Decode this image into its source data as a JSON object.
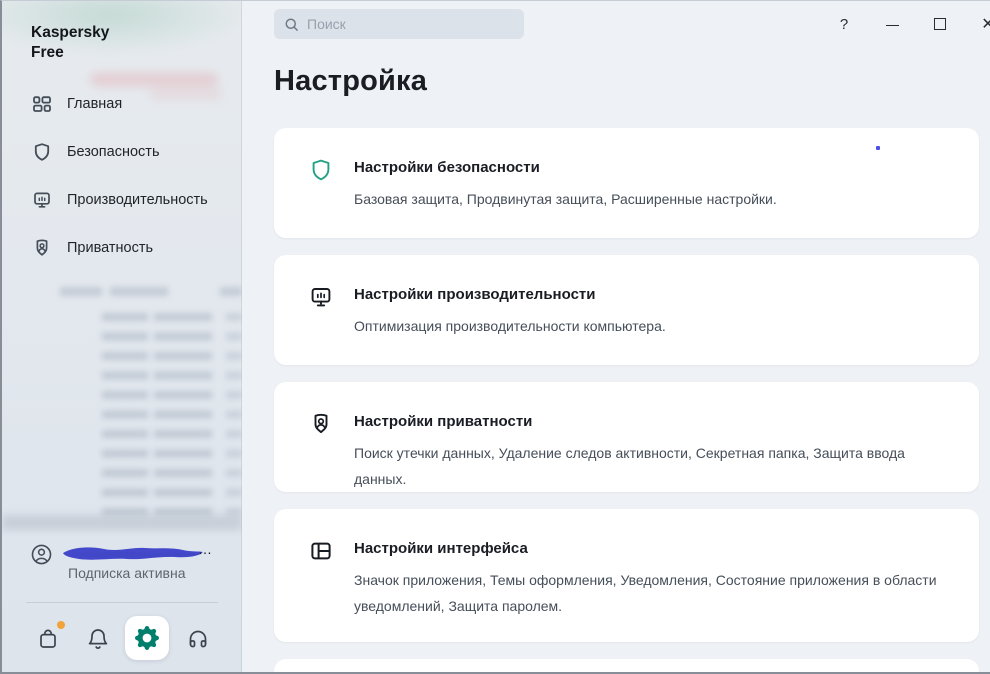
{
  "colors": {
    "accent_teal": "#23a184",
    "gear_active_teal": "#00806c",
    "badge_orange": "#f0a43a",
    "redaction_scribble_blue": "#4449cc",
    "main_background": "#eef1f5",
    "card_background": "#ffffff"
  },
  "window_controls": {
    "help": "?",
    "close": "✕"
  },
  "search": {
    "placeholder": "Поиск",
    "icon": "search-icon"
  },
  "sidebar": {
    "brand_line1": "Kaspersky",
    "brand_line2": "Free",
    "items": [
      {
        "label": "Главная",
        "icon": "dashboard-icon"
      },
      {
        "label": "Безопасность",
        "icon": "shield-icon"
      },
      {
        "label": "Производительность",
        "icon": "monitor-icon"
      },
      {
        "label": "Приватность",
        "icon": "privacy-shield-icon"
      }
    ],
    "account": {
      "subscription_status": "Подписка активна",
      "redacted_name_ellipsis": "…",
      "avatar_icon": "user-avatar-icon"
    },
    "bottom_bar": [
      {
        "icon": "shopping-bag-icon",
        "badge": true
      },
      {
        "icon": "bell-icon"
      },
      {
        "icon": "gear-icon",
        "active": true
      },
      {
        "icon": "headphones-icon"
      }
    ]
  },
  "page": {
    "title": "Настройка"
  },
  "cards": [
    {
      "icon": "shield-icon",
      "title": "Настройки безопасности",
      "description": "Базовая защита, Продвинутая защита, Расширенные настройки."
    },
    {
      "icon": "monitor-icon",
      "title": "Настройки производительности",
      "description": "Оптимизация производительности компьютера."
    },
    {
      "icon": "privacy-shield-icon",
      "title": "Настройки приватности",
      "description": "Поиск утечки данных, Удаление следов активности, Секретная папка, Защита ввода данных."
    },
    {
      "icon": "layout-icon",
      "title": "Настройки интерфейса",
      "description": "Значок приложения, Темы оформления, Уведомления, Состояние приложения в области уведомлений, Защита паролем."
    }
  ]
}
